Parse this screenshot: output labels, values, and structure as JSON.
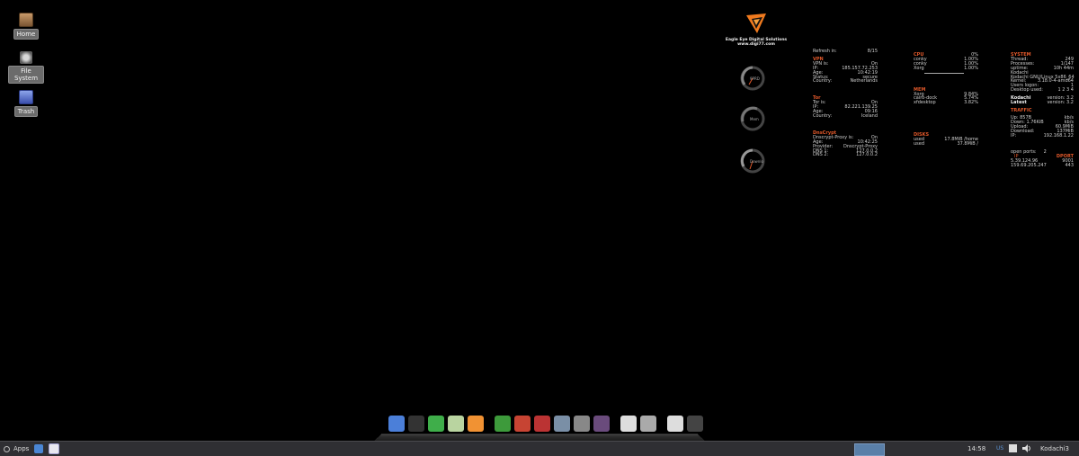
{
  "desktop": {
    "icons": [
      {
        "label": "Home"
      },
      {
        "label": "File System"
      },
      {
        "label": "Trash"
      }
    ]
  },
  "logo": {
    "line1": "Eagle Eye Digital Solutions",
    "line2": "www.digi77.com"
  },
  "gauges": [
    {
      "label": "9PRD"
    },
    {
      "label": "Mem"
    },
    {
      "label": "Downlo"
    }
  ],
  "conky": {
    "refresh": {
      "key": "Refresh in:",
      "value": "8/15"
    },
    "vpn": {
      "title": "VPN",
      "rows": [
        {
          "k": "VPN is:",
          "v": "On"
        },
        {
          "k": "IP:",
          "v": "185.157.72.253"
        },
        {
          "k": "Age:",
          "v": "10:42:19"
        },
        {
          "k": "Status:",
          "v": "secure"
        },
        {
          "k": "Country:",
          "v": "Netherlands"
        }
      ]
    },
    "tor": {
      "title": "Tor",
      "rows": [
        {
          "k": "Tor is:",
          "v": "On"
        },
        {
          "k": "IP:",
          "v": "82.221.139.25"
        },
        {
          "k": "Age:",
          "v": "09:16"
        },
        {
          "k": "Country:",
          "v": "Iceland"
        }
      ]
    },
    "dnscrypt": {
      "title": "DnsCrypt",
      "rows": [
        {
          "k": "Dnscrypt-Proxy is:",
          "v": "On"
        },
        {
          "k": "Age:",
          "v": "10:42:25"
        },
        {
          "k": "Provider:",
          "v": "Dnscrypt-Proxy"
        },
        {
          "k": "DNS 1:",
          "v": "127.0.0.2"
        },
        {
          "k": "DNS 2:",
          "v": "127.0.0.2"
        }
      ]
    },
    "cpu": {
      "title": "CPU",
      "total": "0%",
      "rows": [
        {
          "k": "conky",
          "v": "1.00%"
        },
        {
          "k": "conky",
          "v": "1.00%"
        },
        {
          "k": "Xorg",
          "v": "1.00%"
        }
      ]
    },
    "mem": {
      "title": "MEM",
      "rows": [
        {
          "k": "Xorg",
          "v": "9.84%"
        },
        {
          "k": "cairo-dock",
          "v": "5.74%"
        },
        {
          "k": "xfdesktop",
          "v": "3.82%"
        }
      ]
    },
    "disks": {
      "title": "DISKS",
      "rows": [
        {
          "k": "used",
          "v": "17.8MiB /home"
        },
        {
          "k": "used",
          "v": "37.8MiB /"
        }
      ]
    },
    "system": {
      "title": "SYSTEM",
      "rows": [
        {
          "k": "Thread:",
          "v": "249"
        },
        {
          "k": "Processes:",
          "v": "1/147"
        },
        {
          "k": "uptime:",
          "v": "10h 44m"
        },
        {
          "k": "Kodachi",
          "v": ""
        },
        {
          "k": "Kodachi GNU/Linux 5",
          "v": "x86_64"
        },
        {
          "k": "Kernel:",
          "v": "3.18.0-4-amd64"
        },
        {
          "k": "Users logon:",
          "v": "1"
        },
        {
          "k": "Desktop used:",
          "v": "1 2 3 4"
        }
      ],
      "kodachi": {
        "k": "Kodachi",
        "v": "version: 3.2"
      },
      "latest": {
        "k": "Latest",
        "v": "version: 3.2"
      }
    },
    "traffic": {
      "title": "TRAFFIC",
      "rows": [
        {
          "k": "Up: 857B",
          "v": "kb/s"
        },
        {
          "k": "Down: 1.76KiB",
          "v": "kb/s"
        },
        {
          "k": "Upload:",
          "v": "60.9MiB"
        },
        {
          "k": "Download:",
          "v": "137MiB"
        },
        {
          "k": "IP:",
          "v": "192.168.1.22"
        }
      ]
    },
    "ports": {
      "open_label": "open ports:",
      "open_value": "2",
      "ip_label": "IP",
      "dport_label": "DPORT",
      "rows": [
        {
          "ip": "5.39.124.96",
          "port": "9001"
        },
        {
          "ip": "159.69.205.247",
          "port": "443"
        }
      ]
    }
  },
  "dock": {
    "items": [
      {
        "name": "desktop",
        "color": "#4b7fd9"
      },
      {
        "name": "terminal",
        "color": "#333333"
      },
      {
        "name": "web",
        "color": "#3fae4a"
      },
      {
        "name": "disk",
        "color": "#b9d4a0"
      },
      {
        "name": "firefox",
        "color": "#f19233"
      },
      {
        "name": "store",
        "color": "#3d9a3b"
      },
      {
        "name": "archive",
        "color": "#c74433"
      },
      {
        "name": "tool",
        "color": "#b33"
      },
      {
        "name": "network",
        "color": "#7a8fa6"
      },
      {
        "name": "camera",
        "color": "#888888"
      },
      {
        "name": "package",
        "color": "#6a4b7c"
      },
      {
        "name": "editor",
        "color": "#dddddd"
      },
      {
        "name": "search",
        "color": "#aaaaaa"
      },
      {
        "name": "power",
        "color": "#dddddd"
      },
      {
        "name": "settings",
        "color": "#444444"
      }
    ]
  },
  "taskbar": {
    "apps_label": "Apps",
    "time": "14:58",
    "kbd": "US",
    "user": "Kodachi3"
  }
}
